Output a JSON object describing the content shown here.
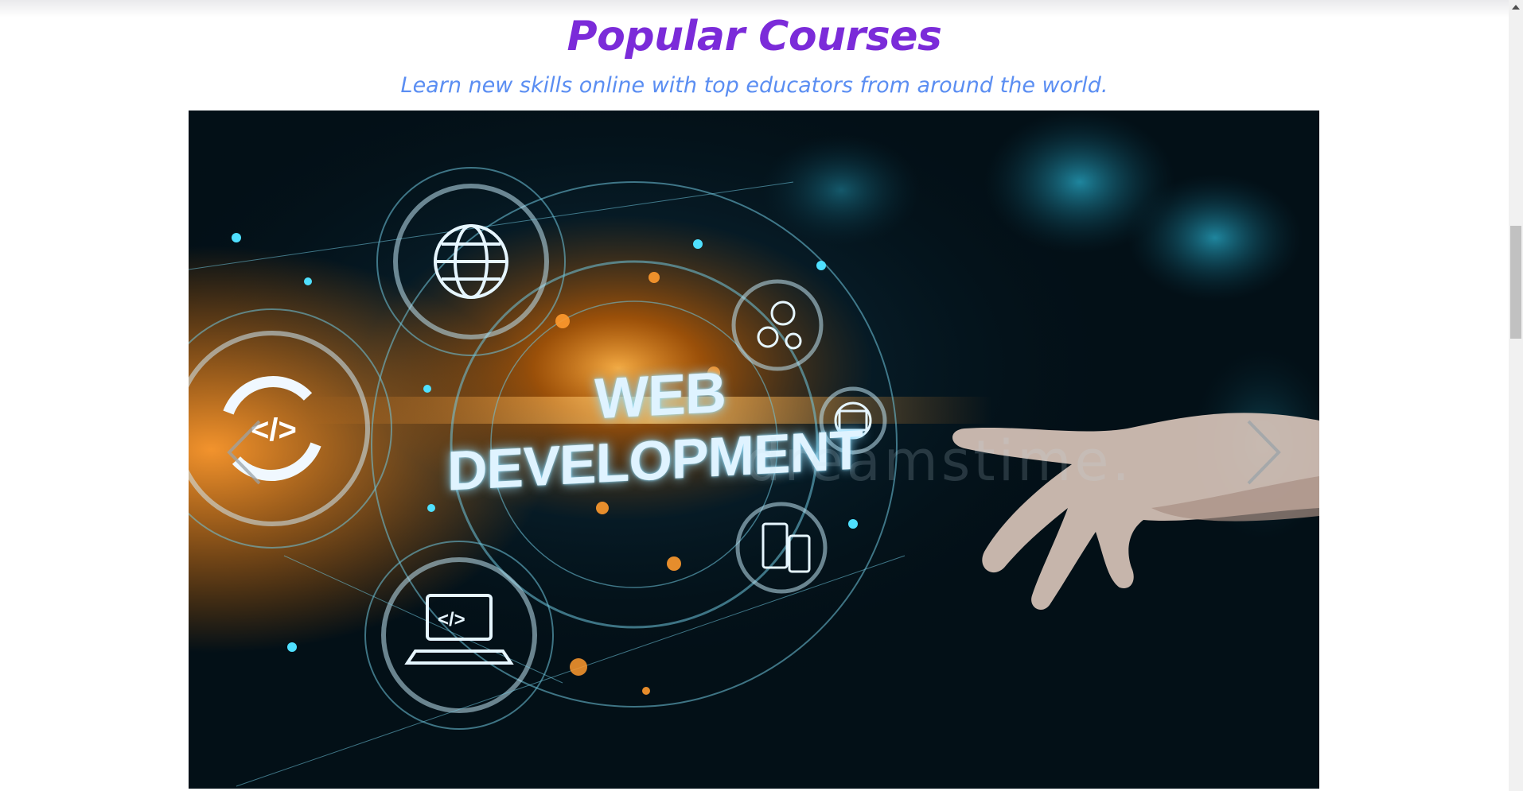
{
  "section": {
    "title": "Popular Courses",
    "subtitle": "Learn new skills online with top educators from around the world."
  },
  "carousel": {
    "slide_heading_line1": "WEB",
    "slide_heading_line2": "DEVELOPMENT",
    "watermark": "dreamstime.",
    "prev_icon": "chevron-left-icon",
    "next_icon": "chevron-right-icon"
  },
  "colors": {
    "title": "#7b2bd9",
    "subtitle": "#5b8ef2",
    "glow_orange": "#ff8a1c",
    "glow_cyan": "#3fd0ff"
  }
}
